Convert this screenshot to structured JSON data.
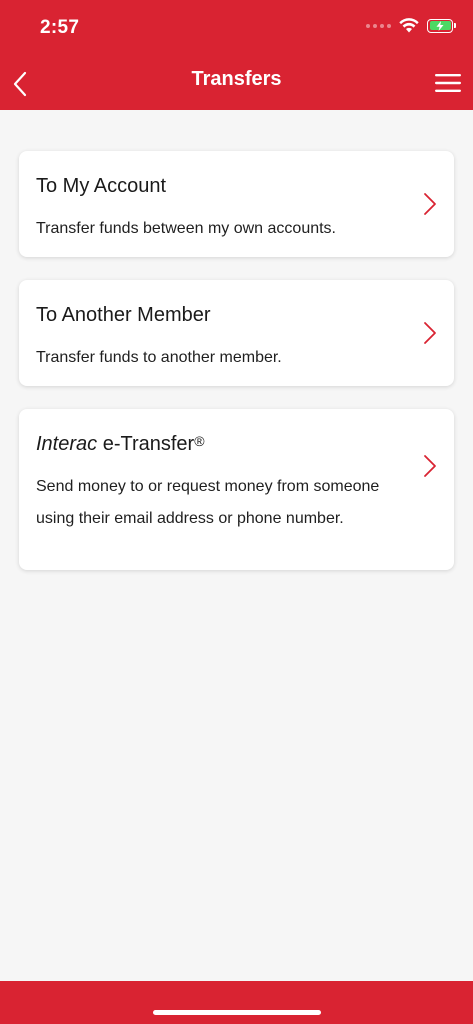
{
  "status_bar": {
    "time": "2:57"
  },
  "nav": {
    "title": "Transfers",
    "back_icon": "chevron-left-icon",
    "menu_icon": "hamburger-menu-icon"
  },
  "cards": [
    {
      "title": "To My Account",
      "description": "Transfer funds between my own accounts."
    },
    {
      "title": "To Another Member",
      "description": "Transfer funds to another member."
    },
    {
      "title_italic": "Interac",
      "title_rest": " e-Transfer",
      "title_mark": "®",
      "description": "Send money to or request money from someone using their email address or phone number."
    }
  ],
  "colors": {
    "brand": "#d92332",
    "background": "#f6f6f6",
    "card": "#ffffff",
    "battery": "#4cd964"
  }
}
